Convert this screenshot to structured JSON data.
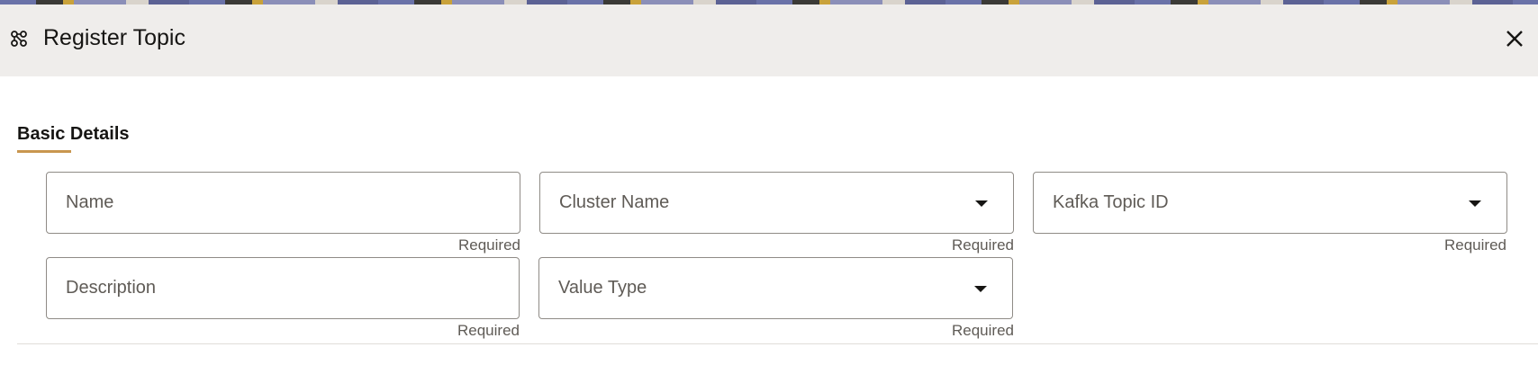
{
  "dialog": {
    "title": "Register Topic",
    "icon": "topic-network-icon",
    "close_icon": "close-icon"
  },
  "section": {
    "title": "Basic Details",
    "accent_color": "#c9964f"
  },
  "fields": {
    "name": {
      "label": "Name",
      "helper": "Required",
      "type": "text"
    },
    "cluster_name": {
      "label": "Cluster Name",
      "helper": "Required",
      "type": "select"
    },
    "kafka_topic_id": {
      "label": "Kafka Topic ID",
      "helper": "Required",
      "type": "select"
    },
    "description": {
      "label": "Description",
      "helper": "Required",
      "type": "text"
    },
    "value_type": {
      "label": "Value Type",
      "helper": "Required",
      "type": "select"
    }
  }
}
